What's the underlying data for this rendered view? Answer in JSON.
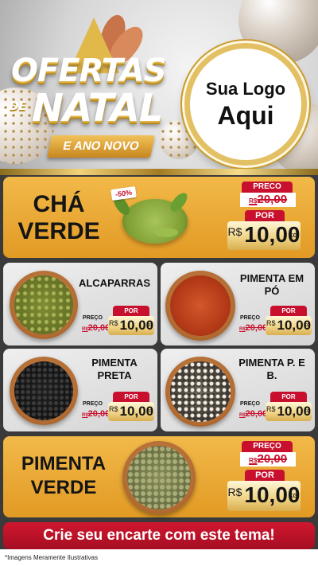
{
  "header": {
    "title_line1": "OFERTAS",
    "title_de": "DE",
    "title_line2": "NATAL",
    "subtitle": "E ANO NOVO",
    "logo_line1": "Sua Logo",
    "logo_line2": "Aqui"
  },
  "featured": [
    {
      "name_line1": "CHÁ",
      "name_line2": "VERDE",
      "discount": "-50%",
      "preco_label": "PRECO",
      "old_currency": "R$",
      "old_price": "20,00",
      "por_label": "POR",
      "new_currency": "R$",
      "new_price": "10,00",
      "unit": "KG"
    },
    {
      "name_line1": "PIMENTA",
      "name_line2": "VERDE",
      "preco_label": "PREÇO",
      "old_currency": "R$",
      "old_price": "20,00",
      "por_label": "POR",
      "new_currency": "R$",
      "new_price": "10,00",
      "unit": "KG"
    }
  ],
  "items": [
    {
      "name": "ALCAPARRAS",
      "preco_label": "PREÇO",
      "old_currency": "R$",
      "old_price": "20,00",
      "por_label": "POR",
      "new_currency": "R$",
      "new_price": "10,00",
      "unit": "KG"
    },
    {
      "name": "PIMENTA EM PÓ",
      "preco_label": "PREÇO",
      "old_currency": "R$",
      "old_price": "20,00",
      "por_label": "POR",
      "new_currency": "R$",
      "new_price": "10,00",
      "unit": "KG"
    },
    {
      "name": "PIMENTA PRETA",
      "preco_label": "PREÇO",
      "old_currency": "R$",
      "old_price": "20,00",
      "por_label": "POR",
      "new_currency": "R$",
      "new_price": "10,00",
      "unit": "KG"
    },
    {
      "name": "PIMENTA P. E B.",
      "preco_label": "PREÇO",
      "old_currency": "R$",
      "old_price": "20,00",
      "por_label": "POR",
      "new_currency": "R$",
      "new_price": "10,00",
      "unit": "KG"
    }
  ],
  "cta_label": "Crie seu encarte com este tema!",
  "footer_note": "*Imagens Meramente Ilustrativas",
  "colors": {
    "banner_gold": "#e9a834",
    "price_red": "#c8102e",
    "card_gray": "#dcdcdc"
  }
}
